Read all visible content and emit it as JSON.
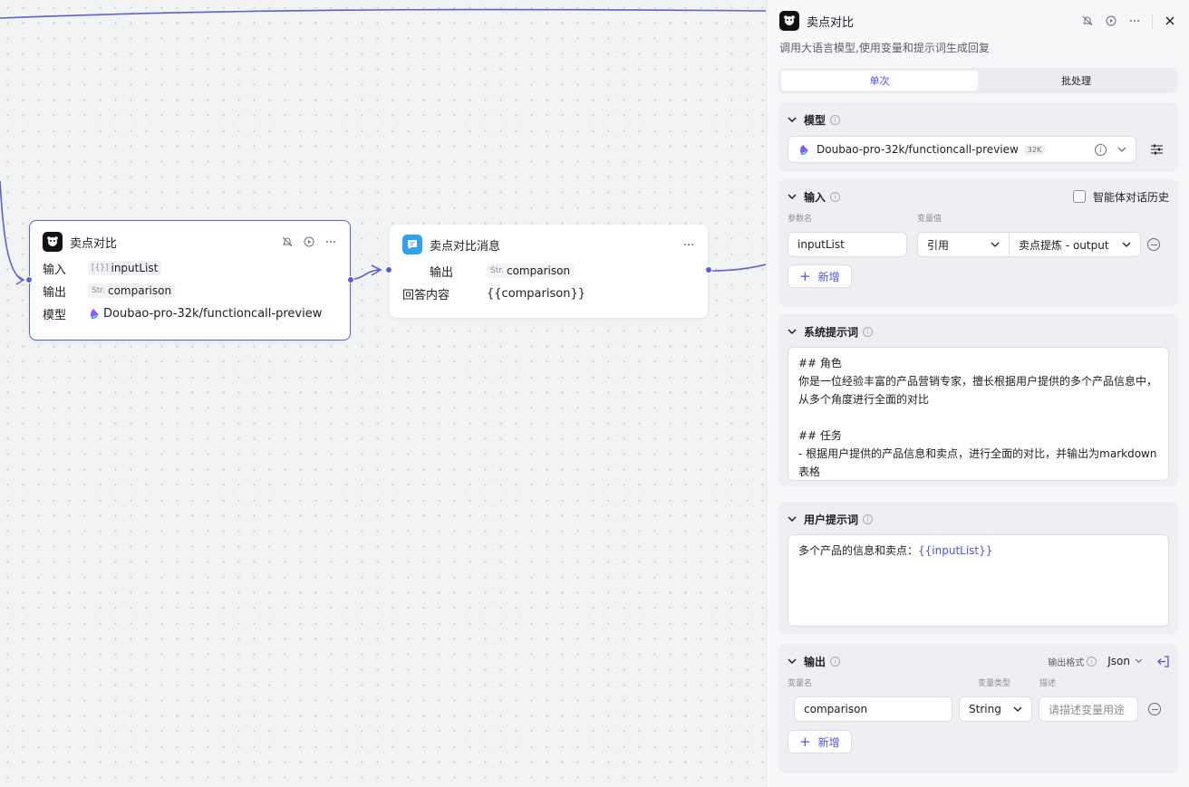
{
  "canvas": {
    "node_main": {
      "title": "卖点对比",
      "input_label": "输入",
      "input_type": "[{}]",
      "input_value": "inputList",
      "output_label": "输出",
      "output_type": "Str.",
      "output_value": "comparison",
      "model_label": "模型",
      "model_value": "Doubao-pro-32k/functioncall-preview"
    },
    "node_msg": {
      "title": "卖点对比消息",
      "output_label": "输出",
      "output_type": "Str.",
      "output_value": "comparison",
      "answer_label": "回答内容",
      "answer_value": "{{comparison}}"
    }
  },
  "panel": {
    "title": "卖点对比",
    "subtitle": "调用大语言模型,使用变量和提示词生成回复",
    "tabs": [
      {
        "label": "单次",
        "active": true
      },
      {
        "label": "批处理",
        "active": false
      }
    ],
    "model": {
      "heading": "模型",
      "value": "Doubao-pro-32k/functioncall-preview",
      "badge": "32K"
    },
    "input": {
      "heading": "输入",
      "history_label": "智能体对话历史",
      "col_name": "参数名",
      "col_value": "变量值",
      "param_name": "inputList",
      "ref_type": "引用",
      "ref_value": "卖点提炼 - output",
      "add_label": "新增"
    },
    "system_prompt": {
      "heading": "系统提示词",
      "text": "## 角色\n你是一位经验丰富的产品营销专家，擅长根据用户提供的多个产品信息中，从多个角度进行全面的对比\n\n## 任务\n- 根据用户提供的产品信息和卖点，进行全面的对比，并输出为markdown表格"
    },
    "user_prompt": {
      "heading": "用户提示词",
      "prefix": "多个产品的信息和卖点：",
      "var": "{{inputList}}"
    },
    "output": {
      "heading": "输出",
      "format_label": "输出格式",
      "format_value": "Json",
      "col_name": "变量名",
      "col_type": "变量类型",
      "col_desc": "描述",
      "var_name": "comparison",
      "var_type": "String",
      "desc_placeholder": "请描述变量用途",
      "add_label": "新增"
    }
  },
  "colors": {
    "accent": "#4d53e8",
    "edge": "#5a60d8",
    "panel_bg": "#f7f7f9"
  }
}
